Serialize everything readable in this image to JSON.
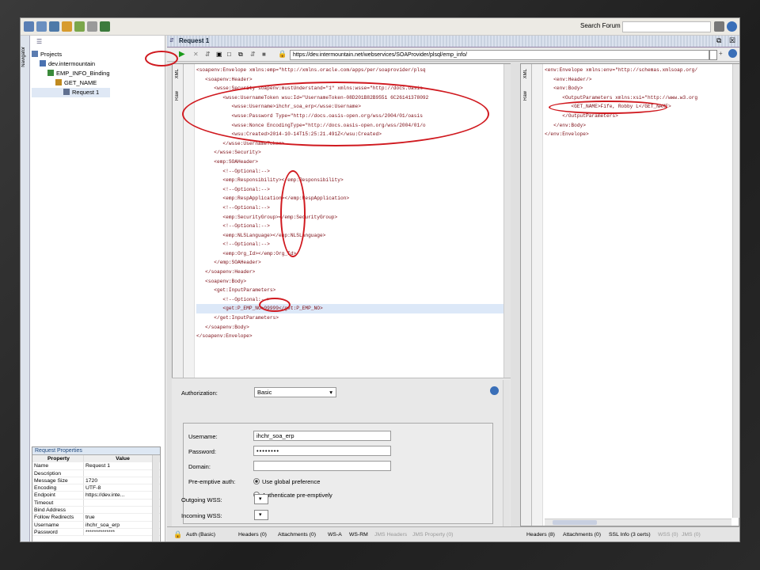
{
  "toolbar": {
    "search_label": "Search Forum"
  },
  "navigator": {
    "label": "Navigator",
    "tree": [
      {
        "label": "Projects",
        "depth": 0
      },
      {
        "label": "dev.intermountain",
        "depth": 1
      },
      {
        "label": "EMP_INFO_Binding",
        "depth": 2
      },
      {
        "label": "GET_NAME",
        "depth": 3
      },
      {
        "label": "Request 1",
        "depth": 4
      }
    ]
  },
  "properties": {
    "title": "Request Properties",
    "headers": [
      "Property",
      "Value"
    ],
    "rows": [
      [
        "Name",
        "Request 1"
      ],
      [
        "Description",
        ""
      ],
      [
        "Message Size",
        "1720"
      ],
      [
        "Encoding",
        "UTF-8"
      ],
      [
        "Endpoint",
        "https://dev.inte..."
      ],
      [
        "Timeout",
        ""
      ],
      [
        "Bind Address",
        ""
      ],
      [
        "Follow Redirects",
        "true"
      ],
      [
        "Username",
        "ihchr_soa_erp"
      ],
      [
        "Password",
        "**************"
      ]
    ]
  },
  "request": {
    "title": "Request 1",
    "url": "https://dev.intermountain.net/webservices/SOAProvider/plsql/emp_info/",
    "tab_raw": "Raw",
    "tab_xml": "XML"
  },
  "xml_lines": [
    "<soapenv:Envelope xmlns:emp=\"http://xmlns.oracle.com/apps/per/soaprovider/plsq",
    "   <soapenv:Header>",
    "      <wsse:Security soapenv:mustUnderstand=\"1\" xmlns:wsse=\"http://docs.oasis-",
    "         <wsse:UsernameToken wsu:Id=\"UsernameToken-08D201B82B9551 6C26141378092",
    "            <wsse:Username>ihchr_soa_erp</wsse:Username>",
    "            <wsse:Password Type=\"http://docs.oasis-open.org/wss/2004/01/oasis",
    "            <wsse:Nonce EncodingType=\"http://docs.oasis-open.org/wss/2004/01/o",
    "            <wsu:Created>2014-10-14T15:25:21.491Z</wsu:Created>",
    "         </wsse:UsernameToken>",
    "      </wsse:Security>",
    "      <emp:SOAHeader>",
    "         <!--Optional:-->",
    "         <emp:Responsibility></emp:Responsibility>",
    "         <!--Optional:-->",
    "         <emp:RespApplication></emp:RespApplication>",
    "         <!--Optional:-->",
    "         <emp:SecurityGroup></emp:SecurityGroup>",
    "         <!--Optional:-->",
    "         <emp:NLSLanguage></emp:NLSLanguage>",
    "         <!--Optional:-->",
    "         <emp:Org_Id></emp:Org_Id>",
    "      </emp:SOAHeader>",
    "   </soapenv:Header>",
    "   <soapenv:Body>",
    "      <get:InputParameters>",
    "         <!--Optional:-->",
    "         <get:P_EMP_NO>99999</get:P_EMP_NO>",
    "      </get:InputParameters>",
    "   </soapenv:Body>",
    "</soapenv:Envelope>"
  ],
  "response_lines": [
    "<env:Envelope xmlns:env=\"http://schemas.xmlsoap.org/",
    "   <env:Header/>",
    "   <env:Body>",
    "      <OutputParameters xmlns:xsi=\"http://www.w3.org",
    "         <GET_NAME>Fife, Robby L</GET_NAME>",
    "      </OutputParameters>",
    "   </env:Body>",
    "</env:Envelope>"
  ],
  "auth": {
    "authorization_label": "Authorization:",
    "authorization_value": "Basic",
    "username_label": "Username:",
    "username_value": "ihchr_soa_erp",
    "password_label": "Password:",
    "password_value": "••••••••",
    "domain_label": "Domain:",
    "domain_value": "",
    "preemptive_label": "Pre-emptive auth:",
    "opt_global": "Use global preference",
    "opt_preemptive": "Authenticate pre-emptively",
    "outgoing_label": "Outgoing WSS:",
    "incoming_label": "Incoming WSS:"
  },
  "request_tabs": [
    "Auth (Basic)",
    "Headers (0)",
    "Attachments (0)",
    "WS-A",
    "WS-RM",
    "JMS Headers",
    "JMS Property (0)"
  ],
  "response_tabs": [
    "Headers (8)",
    "Attachments (0)",
    "SSL Info (3 certs)",
    "WSS (0)",
    "JMS (0)"
  ],
  "colors": {
    "accent": "#d0191f",
    "xml_tag": "#7b0b13",
    "link": "#234a7c"
  }
}
